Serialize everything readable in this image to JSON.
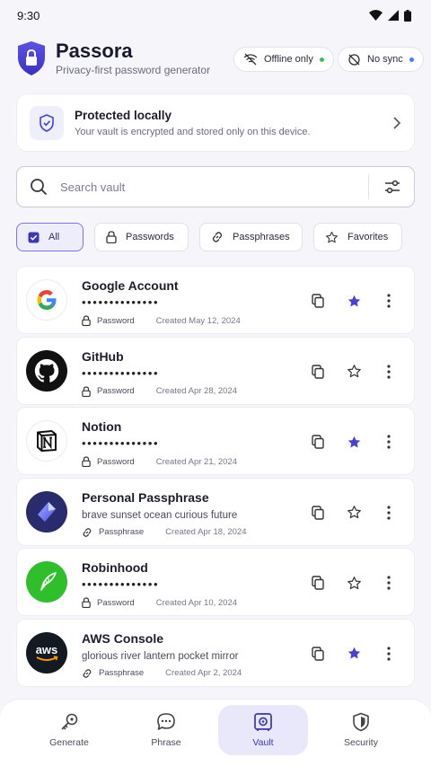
{
  "status_bar": {
    "time": "9:30"
  },
  "app": {
    "name": "Passora",
    "tagline": "Privacy-first password generator"
  },
  "badges": [
    {
      "label": "Offline only",
      "dot_color": "#34c35a"
    },
    {
      "label": "No sync",
      "dot_color": "#3b82f6"
    }
  ],
  "protected_card": {
    "title": "Protected locally",
    "subtitle": "Your vault is encrypted and stored only on this device."
  },
  "search": {
    "placeholder": "Search vault",
    "value": ""
  },
  "filters": [
    {
      "label": "All",
      "icon": "checkbox-icon",
      "active": true
    },
    {
      "label": "Passwords",
      "icon": "lock-icon",
      "active": false
    },
    {
      "label": "Passphrases",
      "icon": "link-icon",
      "active": false
    },
    {
      "label": "Favorites",
      "icon": "star-icon",
      "active": false
    }
  ],
  "entries": [
    {
      "name": "Google Account",
      "secret": "••••••••••••••",
      "type": "Password",
      "created": "Created May 12, 2024",
      "favorite": true,
      "logo": "google-logo"
    },
    {
      "name": "GitHub",
      "secret": "••••••••••••••",
      "type": "Password",
      "created": "Created Apr 28, 2024",
      "favorite": false,
      "logo": "github-logo"
    },
    {
      "name": "Notion",
      "secret": "••••••••••••••",
      "type": "Password",
      "created": "Created Apr 21, 2024",
      "favorite": true,
      "logo": "notion-logo"
    },
    {
      "name": "Personal Passphrase",
      "secret": "brave sunset ocean curious future",
      "type": "Passphrase",
      "created": "Created Apr 18, 2024",
      "favorite": false,
      "logo": "passphrase-logo"
    },
    {
      "name": "Robinhood",
      "secret": "••••••••••••••",
      "type": "Password",
      "created": "Created Apr 10, 2024",
      "favorite": false,
      "logo": "robinhood-logo"
    },
    {
      "name": "AWS Console",
      "secret": "glorious river lantern pocket mirror",
      "type": "Passphrase",
      "created": "Created Apr 2, 2024",
      "favorite": true,
      "logo": "aws-logo"
    }
  ],
  "bottom_nav": [
    {
      "label": "Generate",
      "icon": "key-icon",
      "active": false
    },
    {
      "label": "Phrase",
      "icon": "chat-icon",
      "active": false
    },
    {
      "label": "Vault",
      "icon": "vault-icon",
      "active": true
    },
    {
      "label": "Security",
      "icon": "shield-icon",
      "active": false
    }
  ],
  "colors": {
    "accent": "#4a3fd6",
    "background": "#f6f6fa",
    "active_chip_bg": "#eeedfc"
  }
}
